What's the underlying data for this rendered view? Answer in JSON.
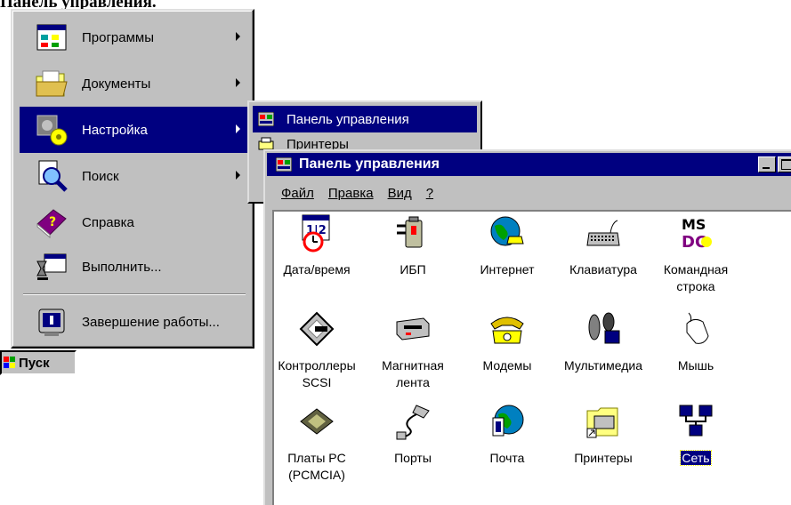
{
  "caption": "Панель управления.",
  "start_menu": {
    "items": [
      {
        "label": "Программы"
      },
      {
        "label": "Документы"
      },
      {
        "label": "Настройка"
      },
      {
        "label": "Поиск"
      },
      {
        "label": "Справка"
      },
      {
        "label": "Выполнить..."
      },
      {
        "label": "Завершение работы..."
      }
    ]
  },
  "start_button": {
    "label": "Пуск"
  },
  "submenu": {
    "items": [
      {
        "label": "Панель управления"
      },
      {
        "label": "Принтеры"
      }
    ]
  },
  "window": {
    "title": "Панель управления",
    "menu": {
      "file": "Файл",
      "edit": "Правка",
      "view": "Вид",
      "help": "?"
    },
    "items": [
      {
        "label": "Дата/время"
      },
      {
        "label": "ИБП"
      },
      {
        "label": "Интернет"
      },
      {
        "label": "Клавиатура"
      },
      {
        "label": "Командная строка"
      },
      {
        "label": "Контроллеры SCSI"
      },
      {
        "label": "Магнитная лента"
      },
      {
        "label": "Модемы"
      },
      {
        "label": "Мультимедиа"
      },
      {
        "label": "Мышь"
      },
      {
        "label": "Платы PC (PCMCIA)"
      },
      {
        "label": "Порты"
      },
      {
        "label": "Почта"
      },
      {
        "label": "Принтеры"
      },
      {
        "label": "Сеть"
      }
    ]
  },
  "colors": {
    "selection": "#000080",
    "face": "#c0c0c0",
    "window_bg": "#ffffff"
  }
}
